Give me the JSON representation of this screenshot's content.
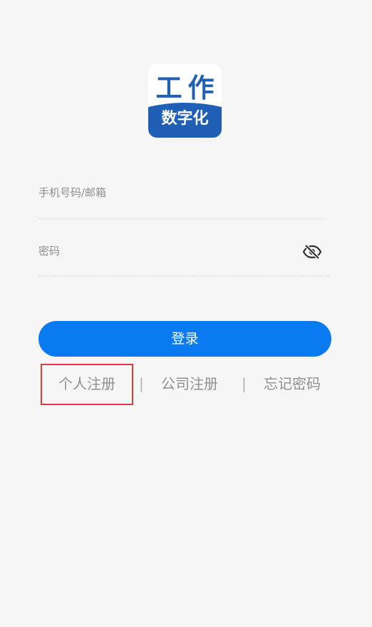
{
  "logo": {
    "top_text": "工作",
    "bottom_text": "数字化",
    "colors": {
      "brand_blue": "#1f5fb6",
      "background": "#ffffff"
    }
  },
  "login_form": {
    "account_placeholder": "手机号码/邮箱",
    "password_placeholder": "密码",
    "visibility_icon": "eye-off-icon",
    "login_button_label": "登录"
  },
  "links": {
    "personal_register": "个人注册",
    "separator_1": "|",
    "company_register": "公司注册",
    "separator_2": "|",
    "forgot_password": "忘记密码"
  },
  "colors": {
    "primary_button": "#0a7af2",
    "link_text": "#909090",
    "highlight_box": "#e03a3a",
    "page_background": "#f6f6f6"
  }
}
